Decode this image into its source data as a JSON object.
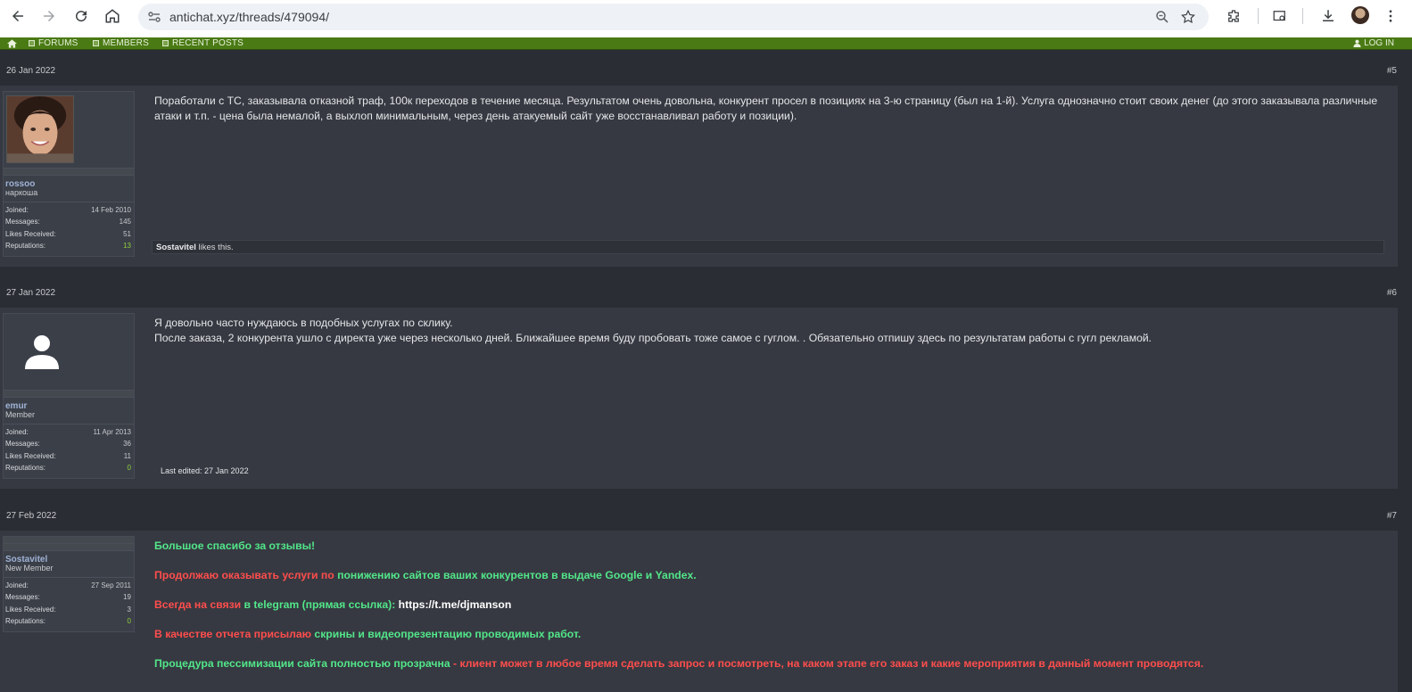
{
  "browser": {
    "url": "antichat.xyz/threads/479094/"
  },
  "sitenav": {
    "forums": "FORUMS",
    "members": "MEMBERS",
    "recent": "RECENT POSTS",
    "login": "LOG IN",
    "bar_color": "#4a7a14"
  },
  "posts": [
    {
      "date": "26 Jan 2022",
      "number": "#5",
      "user": {
        "name": "rossoo",
        "title": "наркоша",
        "joined": "14 Feb 2010",
        "messages": "145",
        "likes": "51",
        "reputations": "13"
      },
      "text": "Поработали с ТС, заказывала отказной траф, 100к переходов в течение месяца. Результатом очень довольна, конкурент просел в позициях на 3-ю страницу (был на 1-й). Услуга однозначно стоит своих денег (до этого заказывала различные атаки и т.п. - цена была немалой, а выхлоп минимальным, через день атакуемый сайт уже восстанавливал работу и позиции).",
      "likes_user": "Sostavitel",
      "likes_suffix": " likes this."
    },
    {
      "date": "27 Jan 2022",
      "number": "#6",
      "user": {
        "name": "emur",
        "title": "Member",
        "joined": "11 Apr 2013",
        "messages": "36",
        "likes": "11",
        "reputations": "0"
      },
      "line1": "Я довольно часто нуждаюсь в подобных услугах по склику.",
      "line2": "После заказа, 2 конкурента ушло с директа уже через несколько дней. Ближайшее время буду пробовать тоже самое с гуглом. . Обязательно отпишу здесь по результатам работы с гугл рекламой.",
      "edited": "Last edited: 27 Jan 2022"
    },
    {
      "date": "27 Feb 2022",
      "number": "#7",
      "user": {
        "name": "Sostavitel",
        "title": "New Member",
        "joined": "27 Sep 2011",
        "messages": "19",
        "likes": "3",
        "reputations": "0"
      },
      "p1": "Большое спасибо за отзывы!",
      "p2a": "Продолжаю оказывать услуги по ",
      "p2b": "понижению сайтов ваших конкурентов в выдаче Google и Yandex.",
      "p3a": "Всегда на связи",
      "p3b": " в telegram (прямая ссылка): ",
      "p3c": "https://t.me/djmanson",
      "p4a": "В качестве отчета присылаю",
      "p4b": " скрины и видеопрезентацию проводимых работ.",
      "p5a": "Процедура пессимизации сайта полностью прозрачна",
      "p5b": " - клиент может в любое время сделать запрос и посмотреть, на каком этапе его заказ и какие мероприятия в данный момент проводятся."
    }
  ],
  "labels": {
    "joined": "Joined:",
    "messages": "Messages:",
    "likes": "Likes Received:",
    "reputations": "Reputations:"
  }
}
